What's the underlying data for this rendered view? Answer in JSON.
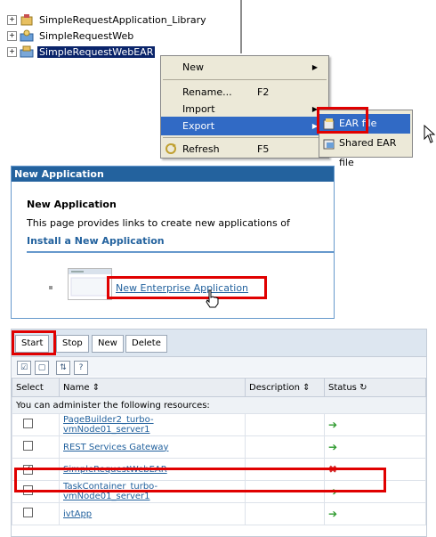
{
  "tree": {
    "items": [
      {
        "label": "SimpleRequestApplication_Library",
        "expander": "+"
      },
      {
        "label": "SimpleRequestWeb",
        "expander": "+"
      },
      {
        "label": "SimpleRequestWebEAR",
        "expander": "+"
      }
    ]
  },
  "context_menu": {
    "new": "New",
    "rename": "Rename...",
    "rename_key": "F2",
    "import": "Import",
    "export": "Export",
    "refresh": "Refresh",
    "refresh_key": "F5"
  },
  "export_submenu": {
    "ear_file": "EAR file",
    "shared_ear_file": "Shared EAR file"
  },
  "new_app_panel": {
    "title_bar": "New Application",
    "heading": "New Application",
    "description": "This page provides links to create new applications of",
    "install_link": "Install a New Application",
    "enterprise_link": "New Enterprise Application"
  },
  "apps_table": {
    "buttons": {
      "start": "Start",
      "stop": "Stop",
      "new": "New",
      "delete": "Delete"
    },
    "columns": {
      "select": "Select",
      "name": "Name",
      "description": "Description",
      "status": "Status"
    },
    "info_row": "You can administer the following resources:",
    "rows": [
      {
        "name_line1": "PageBuilder2_turbo-",
        "name_line2": "vmNode01_server1",
        "status": "running",
        "checked": false
      },
      {
        "name_line1": "REST Services Gateway",
        "name_line2": "",
        "status": "running",
        "checked": false
      },
      {
        "name_line1": "SimpleRequestWebEAR",
        "name_line2": "",
        "status": "stopped",
        "checked": true
      },
      {
        "name_line1": "TaskContainer_turbo-",
        "name_line2": "vmNode01_server1",
        "status": "running",
        "checked": false
      },
      {
        "name_line1": "ivtApp",
        "name_line2": "",
        "status": "running",
        "checked": false
      }
    ]
  },
  "colors": {
    "highlight": "#316ac5",
    "accent_red": "#e00000",
    "link_blue": "#23629e",
    "status_running": "#2e9a2e",
    "status_stopped": "#d42b2b"
  }
}
